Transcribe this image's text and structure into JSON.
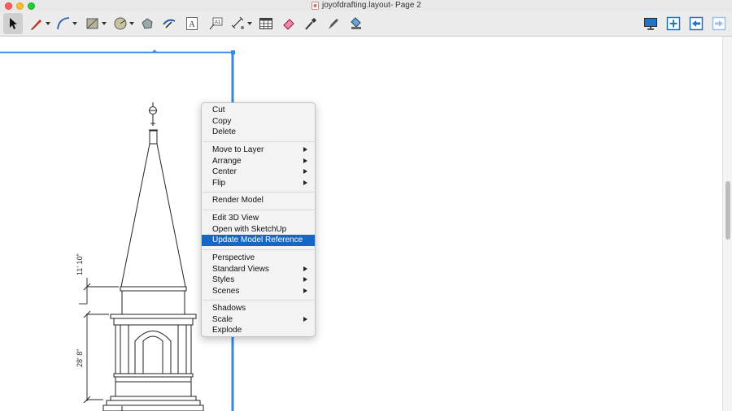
{
  "window": {
    "title": "joyofdrafting.layout- Page 2"
  },
  "toolbar": {
    "left_tools": [
      {
        "name": "select-tool",
        "icon": "arrow-cursor-icon"
      },
      {
        "name": "line-tool",
        "icon": "pencil-icon"
      },
      {
        "name": "arc-tool",
        "icon": "arc-icon"
      },
      {
        "name": "rectangle-tool",
        "icon": "rectangle-icon"
      },
      {
        "name": "circle-tool",
        "icon": "circle-icon"
      },
      {
        "name": "offset-tool",
        "icon": "offset-icon"
      },
      {
        "name": "split-tool",
        "icon": "split-icon"
      },
      {
        "name": "text-tool",
        "icon": "text-icon"
      },
      {
        "name": "label-tool",
        "icon": "label-icon"
      },
      {
        "name": "dimension-tool",
        "icon": "dimension-icon"
      },
      {
        "name": "table-tool",
        "icon": "table-icon"
      },
      {
        "name": "eraser-tool",
        "icon": "eraser-icon"
      },
      {
        "name": "style-tool",
        "icon": "eyedropper-icon"
      },
      {
        "name": "join-tool",
        "icon": "pen-icon"
      },
      {
        "name": "scrapbook-tool",
        "icon": "stamp-icon"
      }
    ],
    "right_tools": [
      {
        "name": "presentation-button",
        "icon": "monitor-icon"
      },
      {
        "name": "add-page-button",
        "icon": "add-page-icon"
      },
      {
        "name": "previous-page-button",
        "icon": "previous-page-icon"
      },
      {
        "name": "next-page-button",
        "icon": "next-page-icon"
      }
    ]
  },
  "drawing": {
    "dimension_upper": "11' 10\"",
    "dimension_lower": "28' 8\""
  },
  "context_menu": {
    "groups": [
      [
        {
          "label": "Cut"
        },
        {
          "label": "Copy"
        },
        {
          "label": "Delete"
        }
      ],
      [
        {
          "label": "Move to Layer",
          "submenu": true
        },
        {
          "label": "Arrange",
          "submenu": true
        },
        {
          "label": "Center",
          "submenu": true
        },
        {
          "label": "Flip",
          "submenu": true
        }
      ],
      [
        {
          "label": "Render Model"
        }
      ],
      [
        {
          "label": "Edit 3D View"
        },
        {
          "label": "Open with SketchUp"
        },
        {
          "label": "Update Model Reference",
          "highlighted": true
        }
      ],
      [
        {
          "label": "Perspective"
        },
        {
          "label": "Standard Views",
          "submenu": true
        },
        {
          "label": "Styles",
          "submenu": true
        },
        {
          "label": "Scenes",
          "submenu": true
        }
      ],
      [
        {
          "label": "Shadows"
        },
        {
          "label": "Scale",
          "submenu": true
        },
        {
          "label": "Explode"
        }
      ]
    ]
  },
  "colors": {
    "selection_blue": "#3388e8",
    "menu_highlight": "#1766c3"
  }
}
